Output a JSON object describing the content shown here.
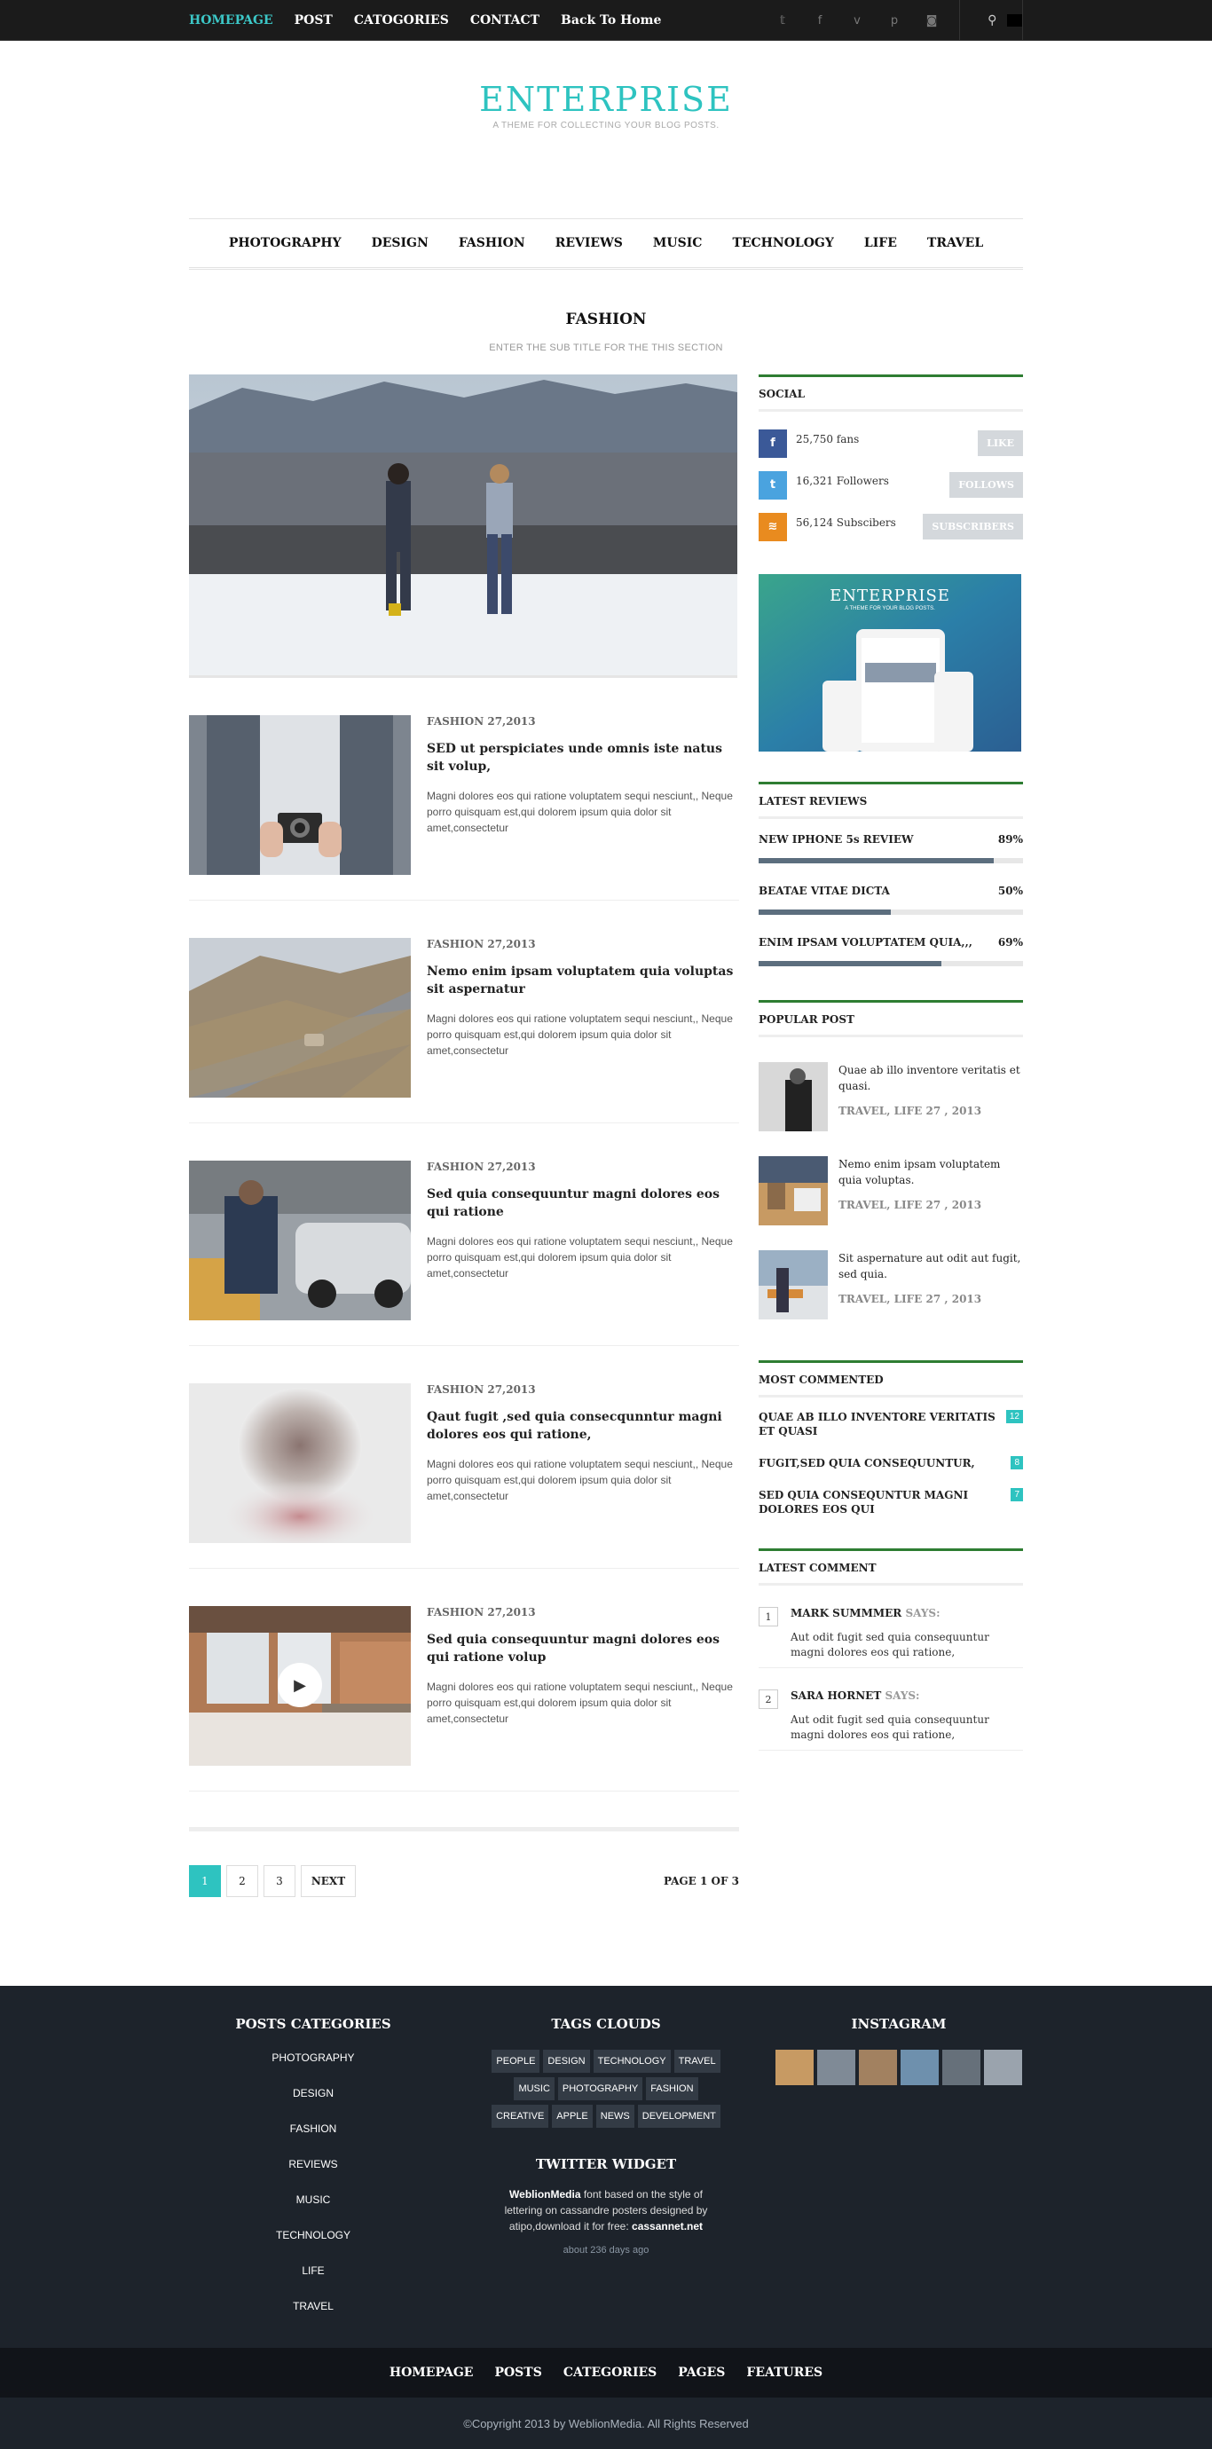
{
  "topbar": {
    "nav": [
      {
        "label": "HOMEPAGE",
        "active": true
      },
      {
        "label": "POST"
      },
      {
        "label": "CATOGORIES"
      },
      {
        "label": "CONTACT"
      },
      {
        "label": "Back To Home"
      }
    ],
    "social_icons": [
      "twitter-icon",
      "facebook-icon",
      "vimeo-icon",
      "pinterest-icon",
      "instagram-icon"
    ],
    "search_icon": "search-icon"
  },
  "logo": {
    "title": "ENTERPRISE",
    "tagline": "A THEME FOR COLLECTING YOUR BLOG POSTS."
  },
  "main_nav": [
    "PHOTOGRAPHY",
    "DESIGN",
    "FASHION",
    "REVIEWS",
    "MUSIC",
    "TECHNOLOGY",
    "LIFE",
    "TRAVEL"
  ],
  "section": {
    "title": "FASHION",
    "subtitle": "ENTER THE SUB TITLE FOR THE THIS SECTION"
  },
  "posts": [
    {
      "meta": "FASHION 27,2013",
      "title": "SED ut perspiciates unde omnis iste natus sit volup,",
      "excerpt": "Magni dolores eos qui ratione voluptatem sequi nesciunt,, Neque porro quisquam est,qui dolorem ipsum quia dolor sit amet,consectetur"
    },
    {
      "meta": "FASHION 27,2013",
      "title": "Nemo enim ipsam voluptatem quia voluptas sit aspernatur",
      "excerpt": "Magni dolores eos qui ratione voluptatem sequi nesciunt,, Neque porro quisquam est,qui dolorem ipsum quia dolor sit amet,consectetur"
    },
    {
      "meta": "FASHION 27,2013",
      "title": "Sed quia consequuntur magni dolores eos qui ratione",
      "excerpt": "Magni dolores eos qui ratione voluptatem sequi nesciunt,, Neque porro quisquam est,qui dolorem ipsum quia dolor sit amet,consectetur"
    },
    {
      "meta": "FASHION 27,2013",
      "title": "Qaut fugit ,sed quia consecqunntur magni dolores eos qui ratione,",
      "excerpt": "Magni dolores eos qui ratione voluptatem sequi nesciunt,, Neque porro quisquam est,qui dolorem ipsum quia dolor sit amet,consectetur"
    },
    {
      "meta": "FASHION 27,2013",
      "title": "Sed quia consequuntur magni dolores eos qui ratione volup",
      "excerpt": "Magni dolores eos qui ratione voluptatem sequi nesciunt,, Neque porro quisquam est,qui dolorem ipsum quia dolor sit amet,consectetur"
    }
  ],
  "pagination": {
    "pages": [
      "1",
      "2",
      "3"
    ],
    "next": "NEXT",
    "status": "PAGE 1 OF 3"
  },
  "sidebar": {
    "social": {
      "title": "SOCIAL",
      "rows": [
        {
          "icon": "facebook-icon",
          "glyph": "f",
          "color": "#3b5998",
          "label": "25,750 fans",
          "button": "LIKE"
        },
        {
          "icon": "twitter-icon",
          "glyph": "t",
          "color": "#4aa3df",
          "label": "16,321 Followers",
          "button": "FOLLOWS"
        },
        {
          "icon": "rss-icon",
          "glyph": "≋",
          "color": "#e98b1f",
          "label": "56,124 Subscibers",
          "button": "SUBSCRIBERS"
        }
      ]
    },
    "ad": {
      "title": "ENTERPRISE",
      "tagline": "A THEME FOR YOUR BLOG POSTS."
    },
    "reviews": {
      "title": "LATEST REVIEWS",
      "items": [
        {
          "name": "NEW IPHONE 5s REVIEW",
          "score": "89%",
          "value": 0.89
        },
        {
          "name": "BEATAE VITAE DICTA",
          "score": "50%",
          "value": 0.5
        },
        {
          "name": "ENIM IPSAM VOLUPTATEM QUIA,,,",
          "score": "69%",
          "value": 0.69
        }
      ]
    },
    "popular": {
      "title": "POPULAR POST",
      "items": [
        {
          "title": "Quae ab illo inventore veritatis et quasi.",
          "meta": "TRAVEL, LIFE 27 , 2013"
        },
        {
          "title": "Nemo enim ipsam voluptatem quia voluptas.",
          "meta": "TRAVEL, LIFE 27 , 2013"
        },
        {
          "title": "Sit aspernature aut odit aut fugit, sed quia.",
          "meta": "TRAVEL, LIFE 27 , 2013"
        }
      ]
    },
    "most_commented": {
      "title": "MOST COMMENTED",
      "items": [
        {
          "title": "QUAE AB ILLO INVENTORE VERITATIS ET QUASI",
          "count": "12"
        },
        {
          "title": "FUGIT,SED QUIA CONSEQUUNTUR,",
          "count": "8"
        },
        {
          "title": "SED QUIA CONSEQUNTUR MAGNI DOLORES EOS QUI",
          "count": "7"
        }
      ]
    },
    "latest_comment": {
      "title": "LATEST COMMENT",
      "says": "SAYS:",
      "items": [
        {
          "num": "1",
          "name": "MARK SUMMMER",
          "text": "Aut odit fugit sed quia consequuntur magni dolores eos qui ratione,"
        },
        {
          "num": "2",
          "name": "SARA HORNET",
          "text": "Aut odit fugit sed quia consequuntur magni dolores eos qui ratione,"
        }
      ]
    }
  },
  "footer": {
    "categories": {
      "title": "POSTS CATEGORIES",
      "items": [
        "PHOTOGRAPHY",
        "DESIGN",
        "FASHION",
        "REVIEWS",
        "MUSIC",
        "TECHNOLOGY",
        "LIFE",
        "TRAVEL"
      ]
    },
    "tags": {
      "title": "TAGS CLOUDS",
      "items": [
        "PEOPLE",
        "DESIGN",
        "TECHNOLOGY",
        "TRAVEL",
        "MUSIC",
        "PHOTOGRAPHY",
        "FASHION",
        "CREATIVE",
        "APPLE",
        "NEWS",
        "DEVELOPMENT"
      ]
    },
    "twitter": {
      "title": "TWITTER WIDGET",
      "author": "WeblionMedia",
      "text": "font based on the style of lettering on cassandre posters designed by atipo,download it for free:",
      "link": "cassannet.net",
      "ago": "about 236 days ago"
    },
    "instagram": {
      "title": "INSTAGRAM"
    },
    "nav": [
      "HOMEPAGE",
      "POSTS",
      "CATEGORIES",
      "PAGES",
      "FEATURES"
    ],
    "copyright": "©Copyright 2013 by WeblionMedia. All Rights Reserved"
  }
}
